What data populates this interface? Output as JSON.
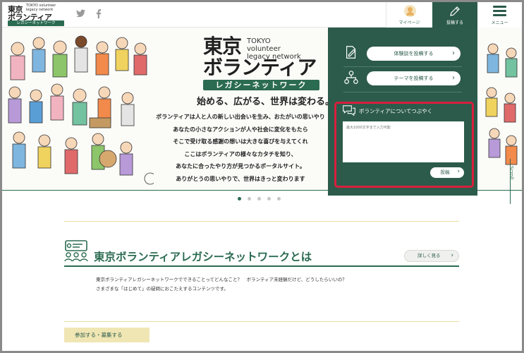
{
  "header": {
    "logo": {
      "main": "東京",
      "en": "TOKYO volunteer legacy network",
      "kana": "ボランティア",
      "ribbon": "レガシーネットワーク"
    },
    "social": [
      {
        "name": "twitter-icon",
        "glyph": "🐦"
      },
      {
        "name": "facebook-icon",
        "glyph": "f"
      }
    ],
    "mypage_label": "マイページ",
    "post_label": "投稿する",
    "menu_label": "メニュー"
  },
  "hero": {
    "logo_big": "東京",
    "logo_en": "TOKYO volunteer legacy network",
    "logo_kana": "ボランティア",
    "logo_ribbon": "レガシーネットワーク",
    "tagline": "始める、広がる、世界は変わる。",
    "lines": [
      "ボランティアは人と人の新しい出会いを生み、おたがいの思いやり",
      "あなたの小さなアクションが人や社会に変化をもたら",
      "そこで受け取る感謝の想いは大きな喜びを与えてくれ",
      "ここはボランティアの様々なカタチを知り、",
      "あなたに合ったやり方が見つかるポータルサイト。",
      "ありがとうの思いやりで、世界はきっと変わります"
    ],
    "scroll_label": "Scroll"
  },
  "panel": {
    "action1": "体験談を投稿する",
    "action2": "テーマを投稿する",
    "tweet_title": "ボランティアについてつぶやく",
    "placeholder": "最大1000文字まで入力可能",
    "submit": "投稿"
  },
  "carousel": {
    "total": 5,
    "active": 0
  },
  "about": {
    "title": "東京ボランティアレガシーネットワークとは",
    "detail_button": "詳しく見る",
    "text_line1": "東京ボランティアレガシーネットワークでできることってどんなこと？　ボランティア未経験だけど、どうしたらいいの？",
    "text_line2": "さまざまな「はじめて」の疑問におこたえするコンテンツです。"
  },
  "join_label": "参加する・募集する",
  "colors": {
    "green": "#2b6b51",
    "panel": "#2c5b4b",
    "highlight": "#d81f3c",
    "sand": "#f0e6b4"
  }
}
